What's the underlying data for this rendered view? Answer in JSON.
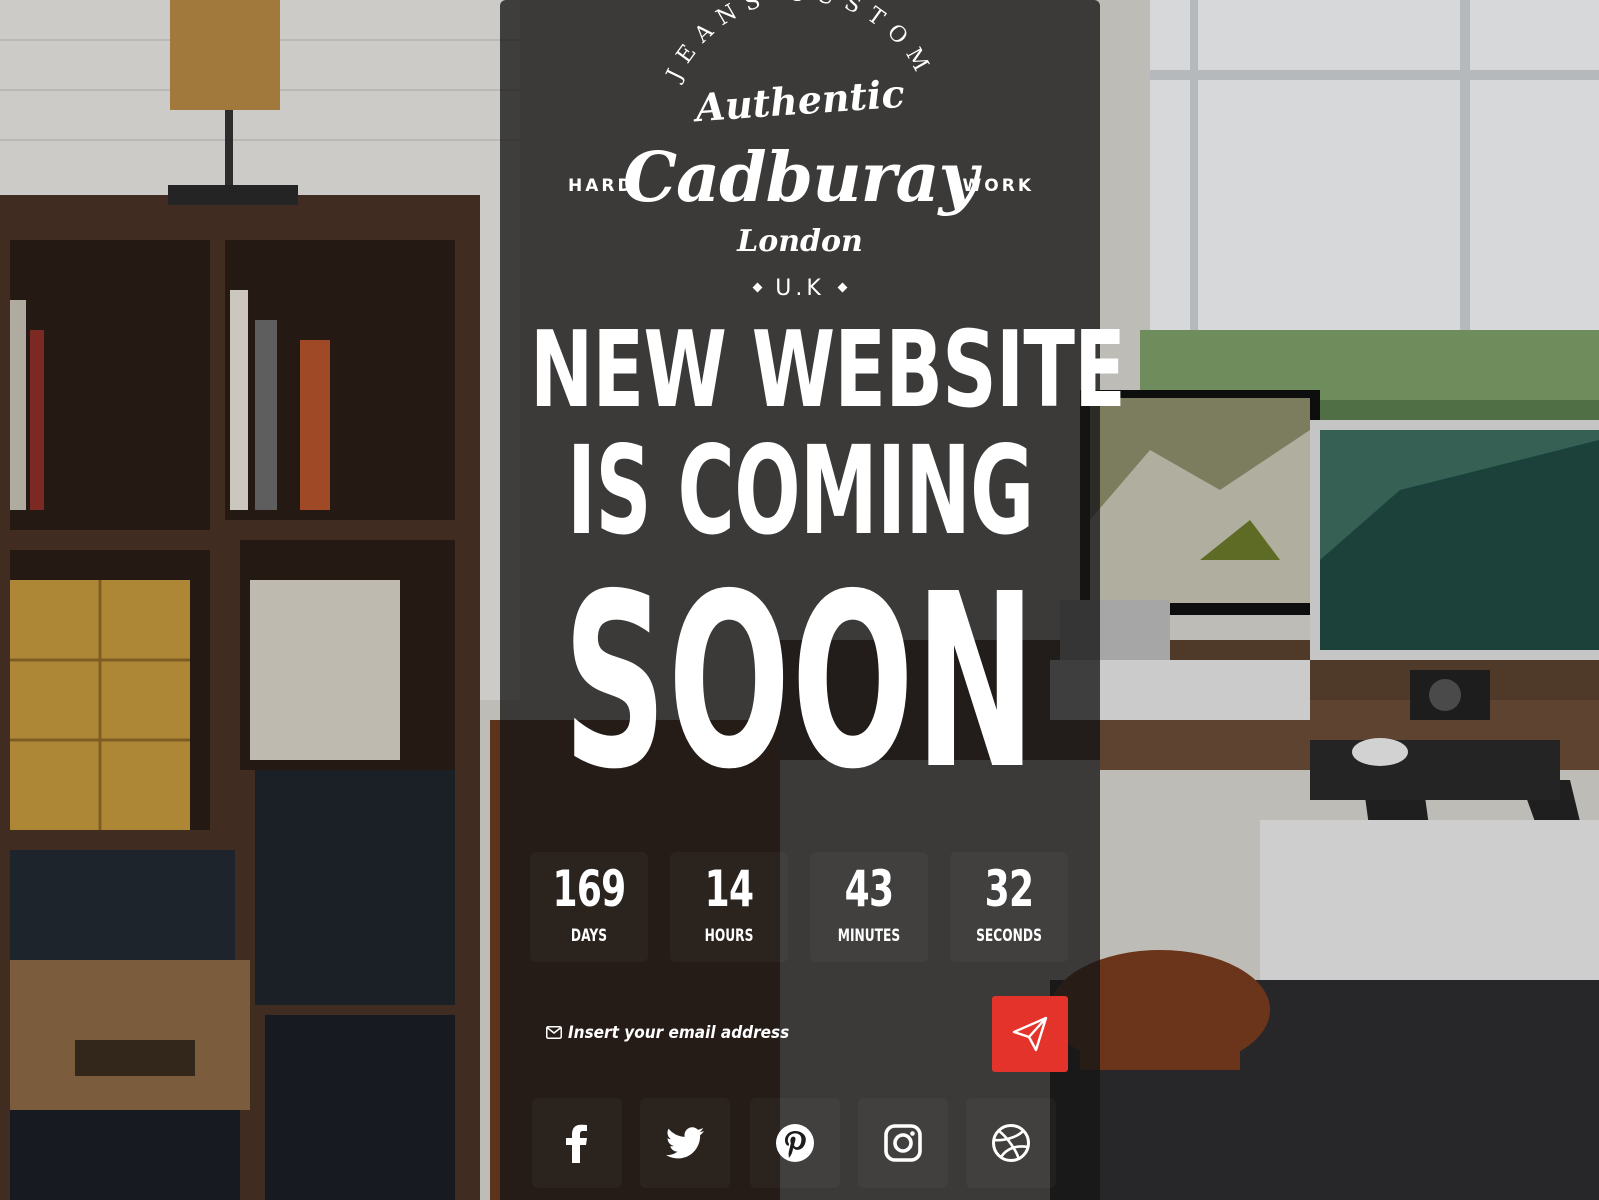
{
  "colors": {
    "panel": "#161616",
    "accent": "#e4332a",
    "text": "#ffffff"
  },
  "logo": {
    "arc_text": "JEANS CUSTOM",
    "tagline": "Authentic",
    "brand": "Cadburay",
    "left_word": "HARD",
    "right_word": "WORK",
    "city": "London",
    "country": "U.K"
  },
  "headline": {
    "line1": "NEW WEBSITE",
    "line2": "IS COMING",
    "line3": "SOON"
  },
  "countdown": [
    {
      "value": "169",
      "label": "DAYS"
    },
    {
      "value": "14",
      "label": "HOURS"
    },
    {
      "value": "43",
      "label": "MINUTES"
    },
    {
      "value": "32",
      "label": "SECONDS"
    }
  ],
  "subscribe": {
    "placeholder": "Insert your email address",
    "icon": "envelope-icon",
    "button_icon": "paper-plane-icon"
  },
  "social": [
    {
      "name": "facebook",
      "icon": "facebook-icon"
    },
    {
      "name": "twitter",
      "icon": "twitter-icon"
    },
    {
      "name": "pinterest",
      "icon": "pinterest-icon"
    },
    {
      "name": "instagram",
      "icon": "instagram-icon"
    },
    {
      "name": "dribbble",
      "icon": "dribbble-icon"
    }
  ]
}
